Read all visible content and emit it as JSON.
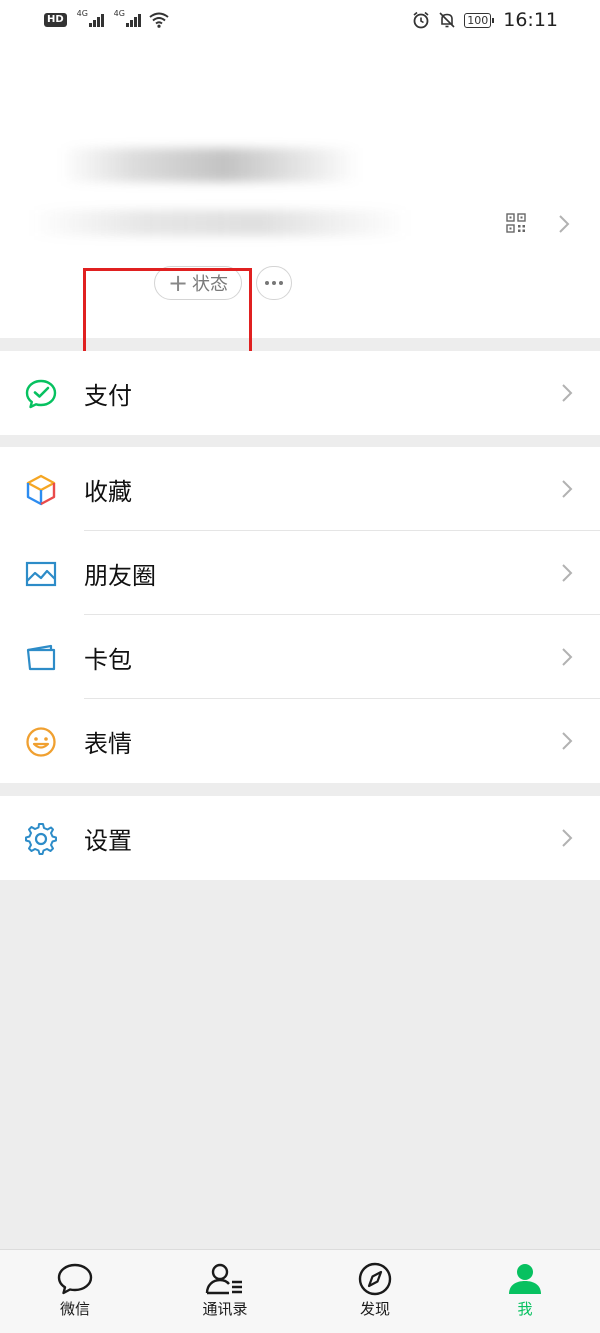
{
  "status_bar": {
    "hd": "HD",
    "sim1": "4G",
    "sim2": "4G",
    "battery": "100",
    "time": "16:11"
  },
  "profile": {
    "status_button_plus": "+",
    "status_button_label": "状态"
  },
  "menu": {
    "pay": "支付",
    "favorites": "收藏",
    "moments": "朋友圈",
    "cards": "卡包",
    "stickers": "表情",
    "settings": "设置"
  },
  "tabs": [
    {
      "label": "微信",
      "icon": "chat-icon"
    },
    {
      "label": "通讯录",
      "icon": "contacts-icon"
    },
    {
      "label": "发现",
      "icon": "compass-icon"
    },
    {
      "label": "我",
      "icon": "me-icon"
    }
  ],
  "colors": {
    "accent": "#07c160",
    "highlight_box": "#e02020",
    "background": "#ededed"
  }
}
